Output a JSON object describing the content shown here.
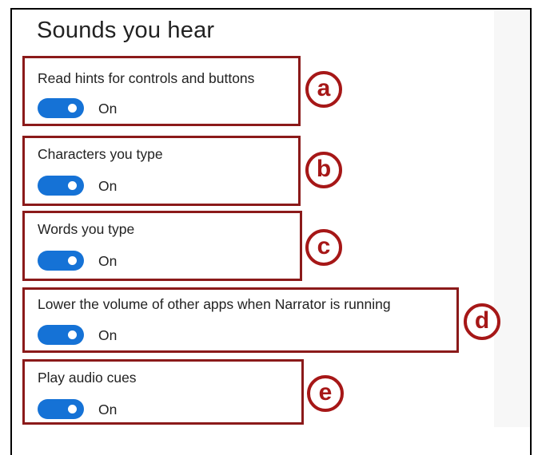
{
  "section": {
    "title": "Sounds you hear"
  },
  "settings": [
    {
      "label": "Read hints for controls and buttons",
      "state": "On",
      "annotation": "a"
    },
    {
      "label": "Characters you type",
      "state": "On",
      "annotation": "b"
    },
    {
      "label": "Words you type",
      "state": "On",
      "annotation": "c"
    },
    {
      "label": "Lower the volume of other apps when Narrator is running",
      "state": "On",
      "annotation": "d"
    },
    {
      "label": "Play audio cues",
      "state": "On",
      "annotation": "e"
    }
  ],
  "colors": {
    "toggle_on": "#1572d6",
    "annotation_red": "#a61717",
    "highlight_border": "#8b1a1a"
  }
}
